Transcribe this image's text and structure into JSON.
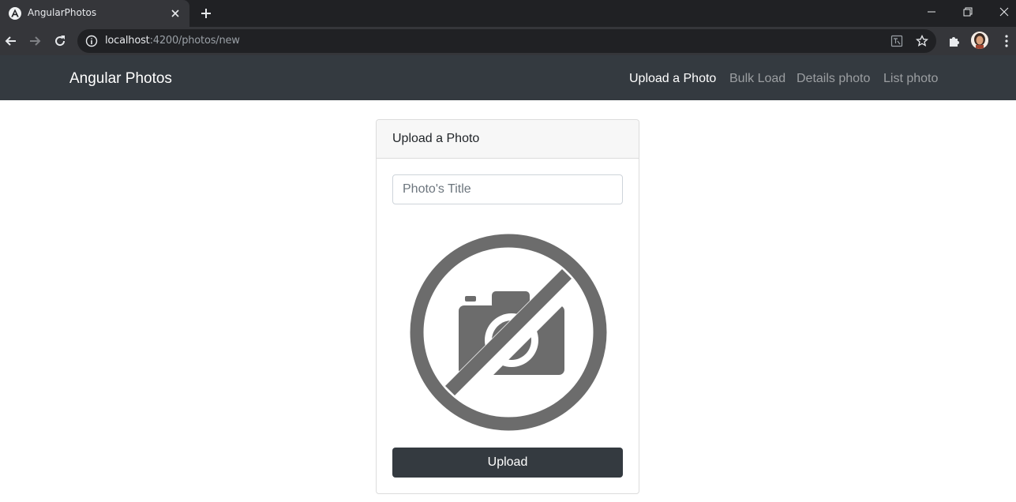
{
  "browser": {
    "tab_title": "AngularPhotos",
    "url_host": "localhost",
    "url_rest": ":4200/photos/new"
  },
  "navbar": {
    "brand": "Angular Photos",
    "links": [
      {
        "label": "Upload a Photo",
        "active": true
      },
      {
        "label": "Bulk Load",
        "active": false
      },
      {
        "label": "Details photo",
        "active": false
      },
      {
        "label": "List photo",
        "active": false
      }
    ]
  },
  "card": {
    "header": "Upload a Photo",
    "title_placeholder": "Photo's Title",
    "preview_icon": "no-camera-icon",
    "upload_label": "Upload"
  },
  "colors": {
    "navbar_bg": "#343a40",
    "button_bg": "#343a40",
    "placeholder_icon": "#6c6c6c"
  }
}
